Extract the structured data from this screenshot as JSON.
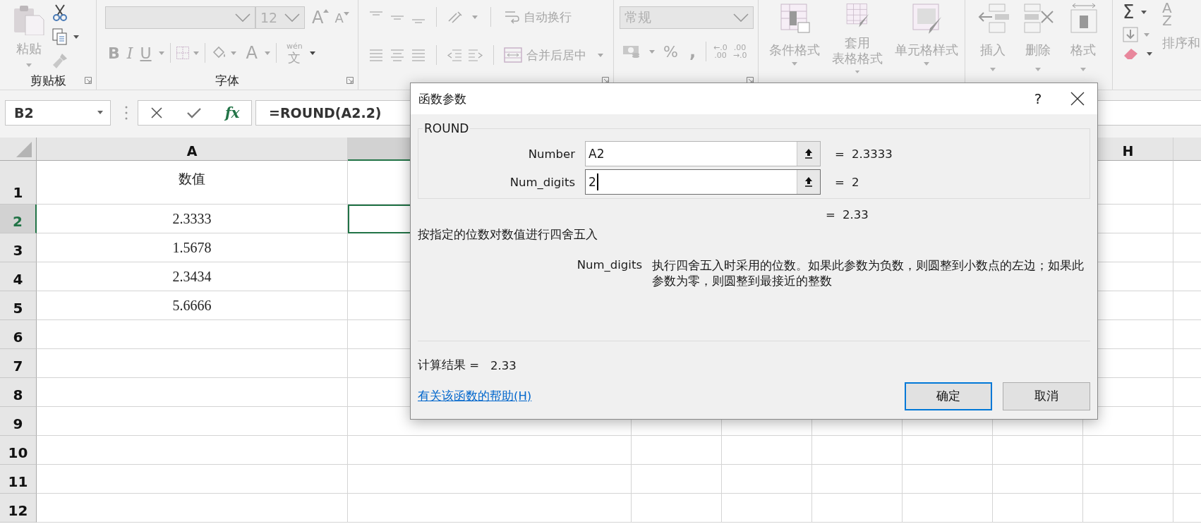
{
  "ribbon": {
    "clipboard": {
      "paste": "粘贴",
      "label": "剪贴板"
    },
    "font": {
      "size": "12",
      "grow": "A",
      "shrink": "A",
      "bold": "B",
      "italic": "I",
      "underline": "U",
      "font_color": "A",
      "phonetic_ruby": "wén",
      "phonetic_base": "文",
      "label": "字体"
    },
    "alignment": {
      "wrap_text": "自动换行",
      "merge": "合并后居中"
    },
    "number": {
      "format": "常规",
      "percent": "%",
      "comma": ",",
      "increase_decimal": [
        "←.0",
        ".00"
      ],
      "decrease_decimal": [
        ".00",
        "→.0"
      ]
    },
    "styles": {
      "items": [
        {
          "kind": "conditional",
          "lines": [
            "条件格式"
          ]
        },
        {
          "kind": "table",
          "lines": [
            "套用",
            "表格格式"
          ]
        },
        {
          "kind": "cellstyle",
          "lines": [
            "单元格样式"
          ]
        }
      ]
    },
    "cells": {
      "items": [
        {
          "kind": "insert",
          "label": "插入"
        },
        {
          "kind": "delete",
          "label": "删除"
        },
        {
          "kind": "format",
          "label": "格式"
        }
      ]
    },
    "editing": {
      "sum": "Σ",
      "sort_icon": [
        "A",
        "Z"
      ],
      "sort": "排序和"
    }
  },
  "formula_bar": {
    "name_box": "B2",
    "fx": "fx",
    "formula": "=ROUND(A2.2)"
  },
  "sheet": {
    "columns": [
      {
        "label": "A",
        "selected": false
      },
      {
        "selected": true
      },
      {},
      {},
      {},
      {},
      {},
      {
        "label": "H",
        "selected": false
      },
      {
        "selected": false
      }
    ],
    "rows": [
      {
        "header": "1",
        "selected": false,
        "cells": [
          "数值"
        ]
      },
      {
        "header": "2",
        "selected": true,
        "cells": [
          "2.3333"
        ]
      },
      {
        "header": "3",
        "selected": false,
        "cells": [
          "1.5678"
        ]
      },
      {
        "header": "4",
        "selected": false,
        "cells": [
          "2.3434"
        ]
      },
      {
        "header": "5",
        "selected": false,
        "cells": [
          "5.6666"
        ]
      },
      {
        "header": "6",
        "selected": false,
        "cells": []
      },
      {
        "header": "7",
        "selected": false,
        "cells": []
      },
      {
        "header": "8",
        "selected": false,
        "cells": []
      },
      {
        "header": "9",
        "selected": false,
        "cells": []
      },
      {
        "header": "10",
        "selected": false,
        "cells": []
      },
      {
        "header": "11",
        "selected": false,
        "cells": []
      },
      {
        "header": "12",
        "selected": false,
        "cells": []
      }
    ]
  },
  "dialog": {
    "title": "函数参数",
    "help": "?",
    "function_name": "ROUND",
    "args": [
      {
        "name": "Number",
        "value": "A2",
        "equals": "=",
        "result": "2.3333",
        "focused": false
      },
      {
        "name": "Num_digits",
        "value": "2",
        "equals": "=",
        "result": "2",
        "focused": true
      }
    ],
    "formula_equals": "=",
    "formula_result": "2.33",
    "description": "按指定的位数对数值进行四舍五入",
    "arg_help_name": "Num_digits",
    "arg_help_text": "执行四舍五入时采用的位数。如果此参数为负数，则圆整到小数点的左边；如果此参数为零，则圆整到最接近的整数",
    "calc_label": "计算结果 =",
    "calc_value": "2.33",
    "help_link": "有关该函数的帮助(H)",
    "buttons": [
      {
        "label": "确定",
        "default": true
      },
      {
        "label": "取消",
        "default": false
      }
    ]
  }
}
